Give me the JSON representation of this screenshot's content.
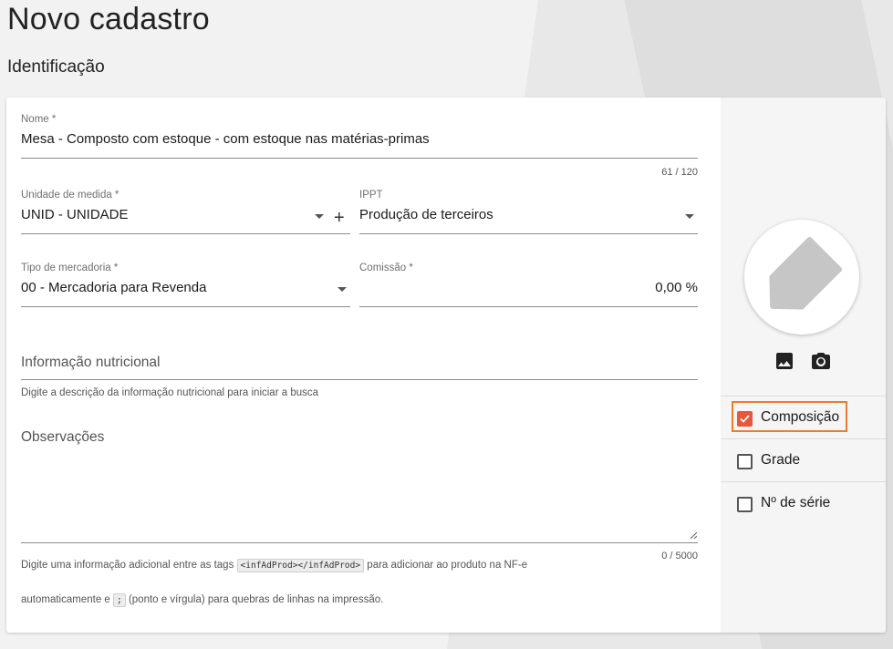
{
  "page": {
    "title": "Novo cadastro",
    "section": "Identificação"
  },
  "form": {
    "nome": {
      "label": "Nome *",
      "value": "Mesa - Composto com estoque - com estoque nas matérias-primas",
      "counter": "61 / 120"
    },
    "unidade": {
      "label": "Unidade de medida *",
      "value": "UNID - UNIDADE",
      "add_symbol": "+"
    },
    "ippt": {
      "label": "IPPT",
      "value": "Produção de terceiros"
    },
    "tipo_mercadoria": {
      "label": "Tipo de mercadoria *",
      "value": "00 - Mercadoria para Revenda"
    },
    "comissao": {
      "label": "Comissão *",
      "value": "0,00 %"
    },
    "info_nutricional": {
      "placeholder": "Informação nutricional",
      "hint": "Digite a descrição da informação nutricional para iniciar a busca"
    },
    "observacoes": {
      "placeholder": "Observações",
      "counter": "0 / 5000",
      "hint_part1": "Digite uma informação adicional entre as tags",
      "hint_code1": "<infAdProd></infAdProd>",
      "hint_part2": "para adicionar ao produto na NF-e",
      "hint_part3": "automaticamente e",
      "hint_code2": ";",
      "hint_part4": "(ponto e vírgula) para quebras de linhas na impressão."
    }
  },
  "side": {
    "image_icon": "image-icon",
    "camera_icon": "camera-icon",
    "placeholder_icon": "price-tag-icon",
    "options": [
      {
        "label": "Composição",
        "checked": true
      },
      {
        "label": "Grade",
        "checked": false
      },
      {
        "label": "Nº de série",
        "checked": false
      }
    ]
  },
  "colors": {
    "accent_orange": "#ef7d22",
    "checkbox_checked": "#e8573a"
  }
}
